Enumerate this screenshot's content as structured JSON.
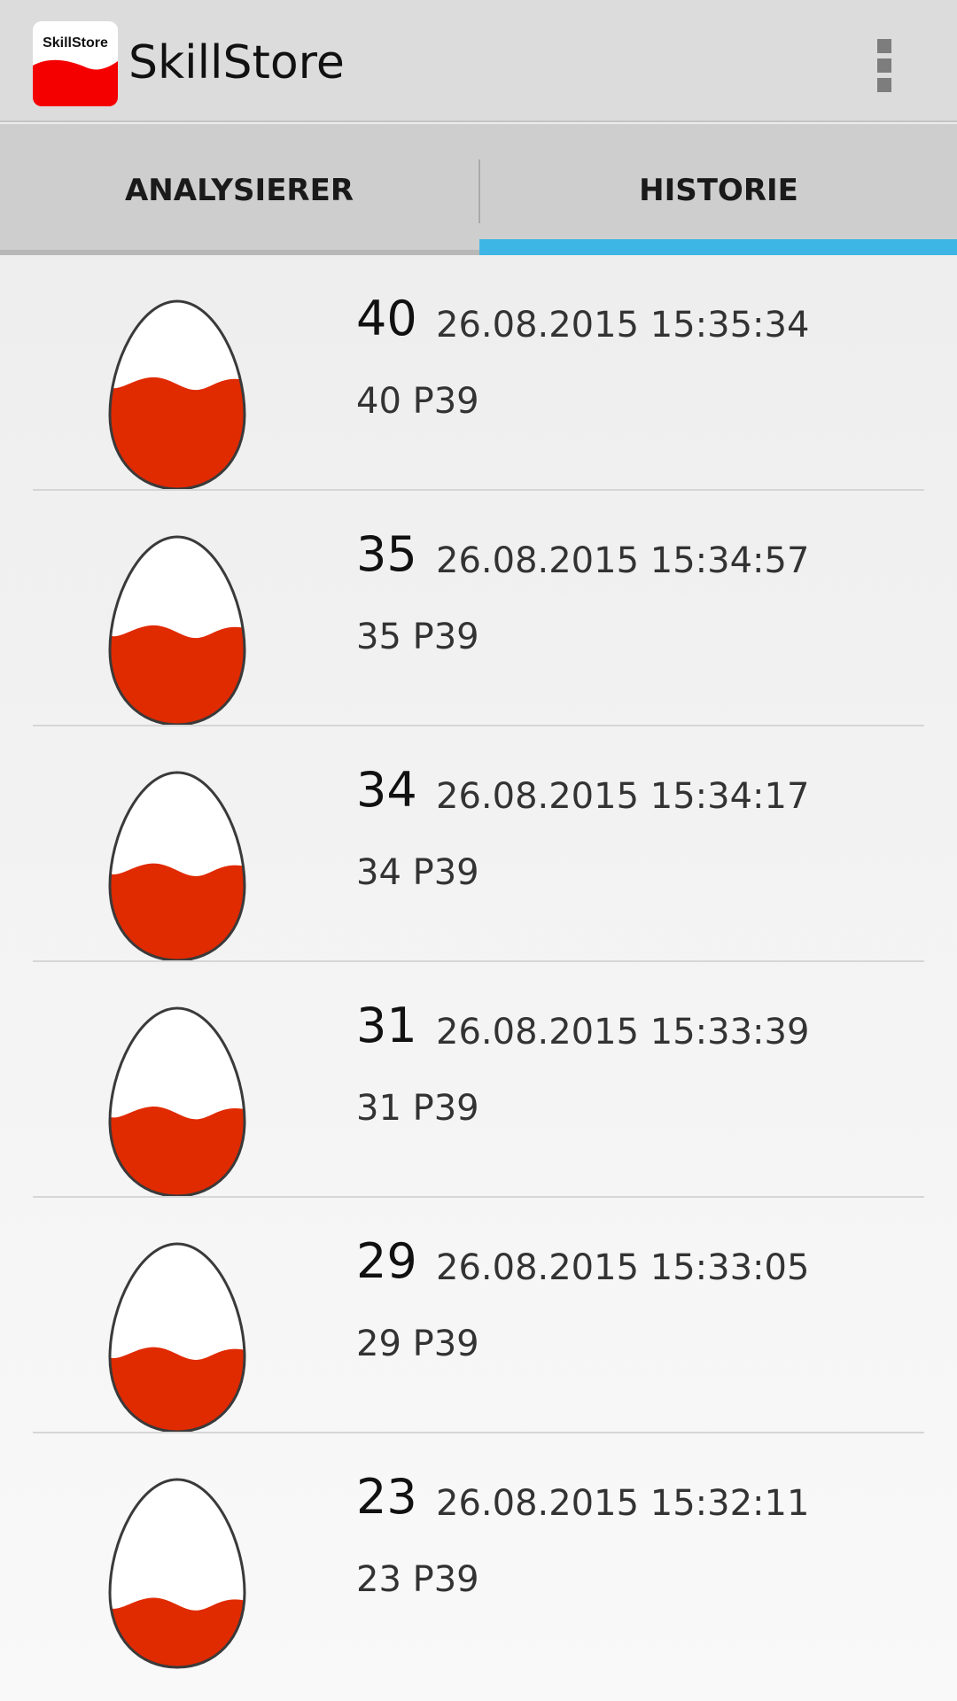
{
  "app": {
    "title": "SkillStore",
    "logo_text": "SkillStore",
    "logo_color": "#f50000"
  },
  "tabs": [
    {
      "label": "ANALYSIERER",
      "active": false
    },
    {
      "label": "HISTORIE",
      "active": true
    }
  ],
  "colors": {
    "accent": "#3db6e6",
    "egg_fill": "#e02a00"
  },
  "history": [
    {
      "score": "40",
      "date": "26.08.2015 15:35:34",
      "detail": "40 P39",
      "fill_level": 0.4
    },
    {
      "score": "35",
      "date": "26.08.2015 15:34:57",
      "detail": "35 P39",
      "fill_level": 0.35
    },
    {
      "score": "34",
      "date": "26.08.2015 15:34:17",
      "detail": "34 P39",
      "fill_level": 0.34
    },
    {
      "score": "31",
      "date": "26.08.2015 15:33:39",
      "detail": "31 P39",
      "fill_level": 0.31
    },
    {
      "score": "29",
      "date": "26.08.2015 15:33:05",
      "detail": "29 P39",
      "fill_level": 0.29
    },
    {
      "score": "23",
      "date": "26.08.2015 15:32:11",
      "detail": "23 P39",
      "fill_level": 0.23
    }
  ]
}
